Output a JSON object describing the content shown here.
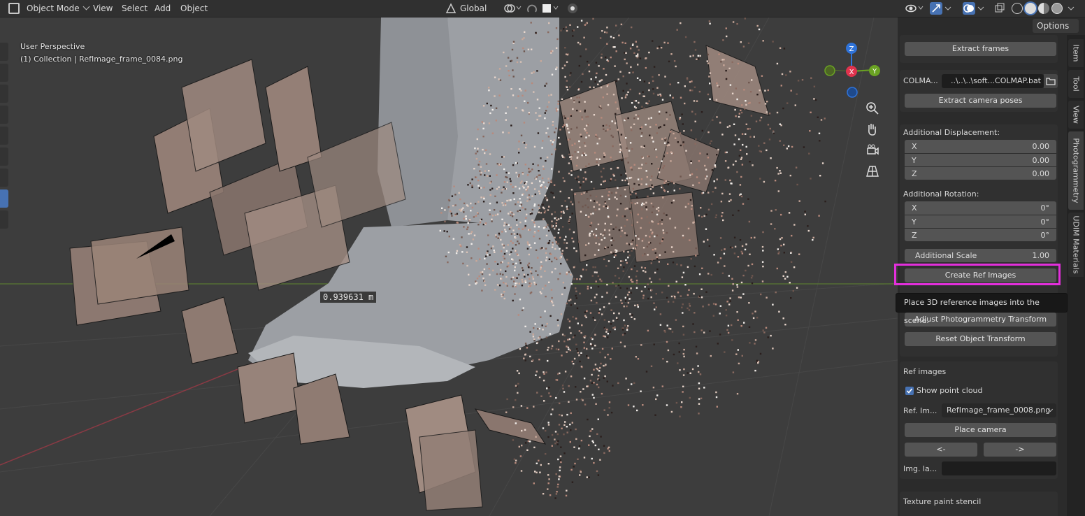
{
  "header": {
    "mode": "Object Mode",
    "menu": [
      "View",
      "Select",
      "Add",
      "Object"
    ],
    "orientation": "Global",
    "options": "Options"
  },
  "viewport": {
    "perspective": "User Perspective",
    "collection": "(1) Collection | RefImage_frame_0084.png",
    "measurement": "0.939631 m",
    "gizmo": {
      "x": "X",
      "y": "Y",
      "z": "Z"
    }
  },
  "panel": {
    "extract_frames": "Extract frames",
    "colmap_label": "COLMA...",
    "colmap_path": "..\\..\\..\\soft...COLMAP.bat",
    "extract_camera_poses": "Extract camera poses",
    "additional_displacement": {
      "label": "Additional Displacement:",
      "x_label": "X",
      "x": "0.00",
      "y_label": "Y",
      "y": "0.00",
      "z_label": "Z",
      "z": "0.00"
    },
    "additional_rotation": {
      "label": "Additional Rotation:",
      "x_label": "X",
      "x": "0°",
      "y_label": "Y",
      "y": "0°",
      "z_label": "Z",
      "z": "0°"
    },
    "additional_scale": {
      "label": "Additional Scale",
      "value": "1.00"
    },
    "create_ref_images": "Create Ref Images",
    "tooltip": "Place 3D reference images into the scene.",
    "adjust_transform": "Adjust Photogrammetry Transform",
    "reset_transform": "Reset Object Transform",
    "ref_images": {
      "title": "Ref images",
      "show_point_cloud": "Show point cloud",
      "show_point_cloud_checked": true,
      "ref_image_label": "Ref. Im...",
      "ref_image_value": "RefImage_frame_0008.png",
      "place_camera": "Place camera",
      "prev": "<-",
      "next": "->",
      "img_label": "Img. la...",
      "img_value": ""
    },
    "texture_paint_stencil": "Texture paint stencil"
  },
  "tabs": [
    "Item",
    "Tool",
    "View",
    "Photogrammetry",
    "UDIM Materials"
  ],
  "active_tab": "Photogrammetry",
  "colors": {
    "highlight": "#e32fdc",
    "accent": "#4772b3",
    "x_axis": "#e0334d",
    "y_axis": "#6aa223",
    "z_axis": "#2f73d9"
  }
}
